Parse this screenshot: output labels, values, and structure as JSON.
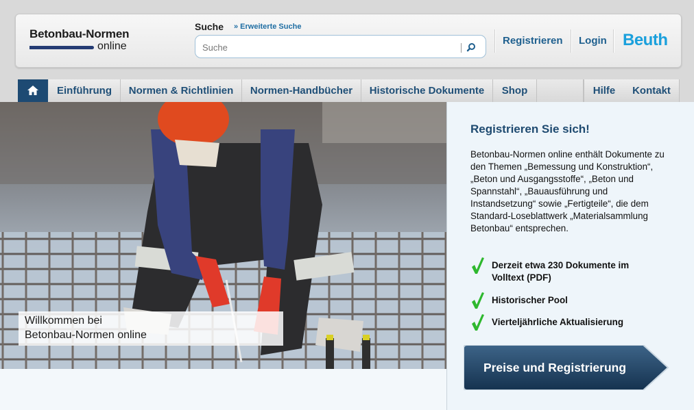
{
  "header": {
    "logo_title": "Betonbau-Normen",
    "logo_subtitle": "online",
    "search_label": "Suche",
    "advanced_search": "» Erweiterte Suche",
    "search_placeholder": "Suche",
    "register": "Registrieren",
    "login": "Login",
    "brand": "Beuth"
  },
  "nav": {
    "items": [
      "Einführung",
      "Normen & Richtlinien",
      "Normen-Handbücher",
      "Historische Dokumente",
      "Shop"
    ],
    "right_items": [
      "Hilfe",
      "Kontakt"
    ]
  },
  "hero": {
    "caption_line1": "Willkommen bei",
    "caption_line2": "Betonbau-Normen online"
  },
  "panel": {
    "title": "Registrieren Sie sich!",
    "text": "Betonbau-Normen online enthält Dokumente zu den Themen „Bemessung und Konstruktion“, „Beton und Ausgangsstoffe“, „Beton und Spannstahl“, „Bauausführung und Instandsetzung“ sowie „Fertigteile“, die dem Standard-Loseblattwerk „Materialsammlung Betonbau“ entsprechen.",
    "features": [
      "Derzeit etwa 230 Dokumente im Volltext (PDF)",
      "Historischer Pool",
      "Vierteljährliche Aktualisierung"
    ],
    "cta": "Preise und Registrierung"
  },
  "colors": {
    "nav_text": "#1f4f77",
    "link": "#1e5f8e",
    "brand": "#1aa0dc",
    "check": "#2eb82e",
    "cta": "#1e3f63"
  }
}
